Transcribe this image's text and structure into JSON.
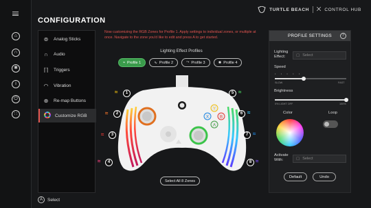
{
  "header": {
    "title": "CONFIGURATION",
    "brand_left": "TURTLE BEACH",
    "brand_right": "CONTROL HUB"
  },
  "rail": {
    "icons": [
      "home-icon",
      "headset-icon",
      "settings-icon",
      "info-icon",
      "power-icon",
      "controller-icon"
    ]
  },
  "menu": {
    "items": [
      {
        "label": "Analog Sticks",
        "icon": "analog-stick-icon"
      },
      {
        "label": "Audio",
        "icon": "audio-icon"
      },
      {
        "label": "Triggers",
        "icon": "trigger-icon"
      },
      {
        "label": "Vibration",
        "icon": "vibration-icon"
      },
      {
        "label": "Re-map Buttons",
        "icon": "remap-icon"
      },
      {
        "label": "Customize RGB",
        "icon": "rgb-icon"
      }
    ],
    "active_index": 5
  },
  "main": {
    "notice": "Now customizing the RGB Zones for Profile 1. Apply settings to individual zones, or multiple at once. Navigate to the zone you'd like to edit and press A to get started.",
    "lighting_title": "Lighting Effect Profiles",
    "profiles": [
      "Profile 1",
      "Profile 2",
      "Profile 3",
      "Profile 4"
    ],
    "active_profile": 0,
    "zones": [
      "1",
      "2",
      "3",
      "4",
      "5",
      "6",
      "7",
      "8"
    ],
    "select_all": "Select All 8 Zones"
  },
  "panel": {
    "title": "PROFILE SETTINGS",
    "lighting_effect_label": "Lighting Effect:",
    "select_placeholder": "Select",
    "speed_label": "Speed",
    "speed_slow": "SLOW",
    "speed_fast": "FAST",
    "brightness_label": "Brightness",
    "brightness_off": "0% LIGHT OFF",
    "brightness_max": "100%",
    "color_label": "Color",
    "loop_label": "Loop",
    "activate_label": "Activate With:",
    "activate_placeholder": "Select",
    "default_button": "Default",
    "undo_button": "Undo",
    "speed_value": 0.4,
    "brightness_value": 1.0
  },
  "footer": {
    "button": "A",
    "label": "Select"
  },
  "colors": {
    "accent_red": "#e2544f",
    "profile_green": "#3a9b4b"
  }
}
